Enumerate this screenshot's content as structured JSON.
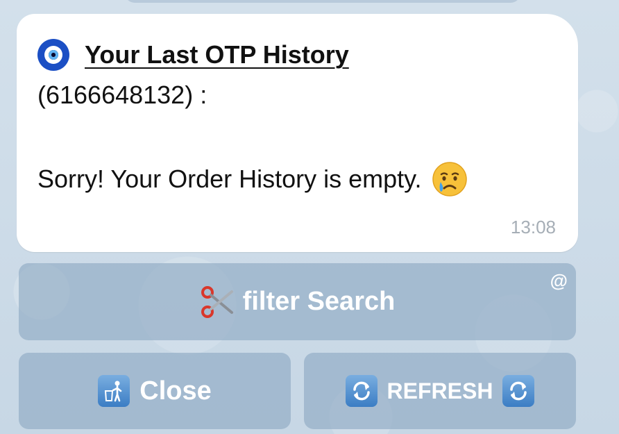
{
  "message": {
    "title": "Your Last OTP History",
    "number_line": "(6166648132) :",
    "body": "Sorry! Your Order History is empty.",
    "time": "13:08",
    "title_icon": "nazar-amulet-icon",
    "body_icon": "crying-face-icon"
  },
  "keyboard": {
    "filter_label": "filter Search",
    "filter_icon": "scissors-icon",
    "switch_inline_symbol": "@",
    "close_label": "Close",
    "close_icon": "litter-in-bin-icon",
    "refresh_label": "REFRESH",
    "refresh_icon": "refresh-arrows-icon"
  },
  "colors": {
    "bubble": "#ffffff",
    "background": "#cfdde9",
    "button": "#8ca8c2",
    "time_text": "#a6aeb6",
    "icon_blue": "#3b7dc4"
  }
}
